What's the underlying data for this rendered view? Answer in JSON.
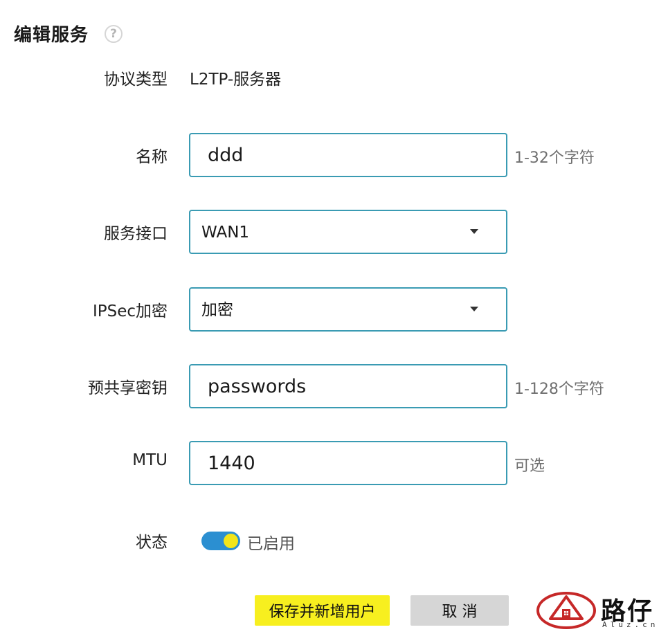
{
  "header": {
    "title": "编辑服务",
    "help_icon": "?"
  },
  "form": {
    "protocol": {
      "label": "协议类型",
      "value": "L2TP-服务器"
    },
    "name": {
      "label": "名称",
      "value": "ddd",
      "hint": "1-32个字符"
    },
    "interface": {
      "label": "服务接口",
      "selected": "WAN1"
    },
    "ipsec": {
      "label": "IPSec加密",
      "selected": "加密"
    },
    "psk": {
      "label": "预共享密钥",
      "value": "passwords",
      "hint": "1-128个字符"
    },
    "mtu": {
      "label": "MTU",
      "value": "1440",
      "hint": "可选"
    },
    "status": {
      "label": "状态",
      "enabled": true,
      "text": "已启用"
    }
  },
  "buttons": {
    "save_add_user": "保存并新增用户",
    "cancel": "取 消"
  },
  "watermark": {
    "text": "路仔",
    "domain": "Aluz.cn"
  },
  "colors": {
    "field_border": "#3a9bb3",
    "primary_button": "#f7ef1f",
    "cancel_button": "#d6d6d6",
    "toggle_on": "#2b8fd1",
    "toggle_knob": "#f2e51a",
    "logo_red": "#c62828"
  }
}
